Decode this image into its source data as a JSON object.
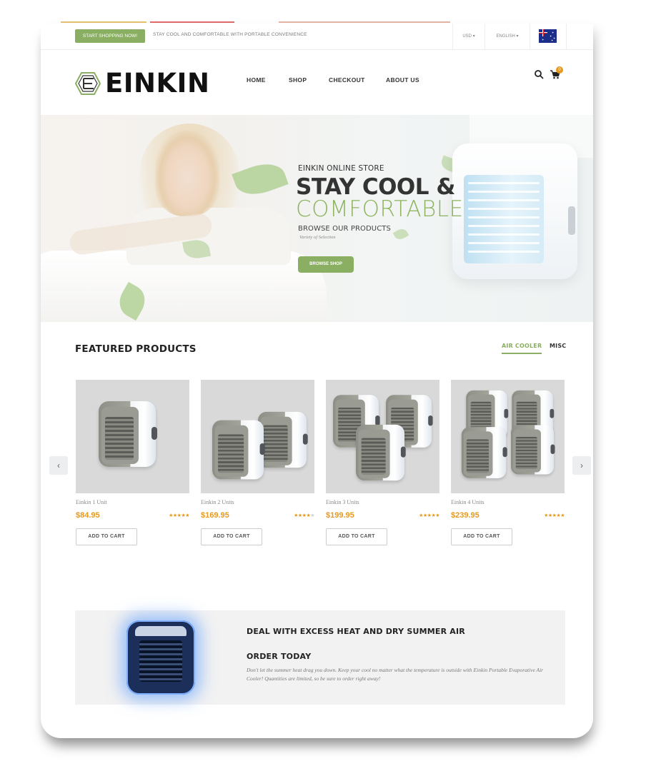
{
  "topbar": {
    "start_button": "START SHOPPING NOW!",
    "tagline": "STAY COOL AND COMFORTABLE WITH PORTABLE CONVENIENCE",
    "currency": "USD ▾",
    "language": "ENGLISH ▾"
  },
  "brand": {
    "name": "EINKIN"
  },
  "nav": {
    "home": "HOME",
    "shop": "SHOP",
    "checkout": "CHECKOUT",
    "about": "ABOUT US"
  },
  "cart": {
    "count": "0"
  },
  "hero": {
    "kicker": "EINKIN ONLINE STORE",
    "title_line1": "STAY COOL &",
    "title_line2": "COMFORTABLE",
    "subtitle": "BROWSE OUR PRODUCTS",
    "note": "Variety of Selection",
    "button": "BROWSE SHOP"
  },
  "featured": {
    "title": "FEATURED PRODUCTS",
    "tabs": [
      "AIR COOLER",
      "MISC"
    ],
    "products": [
      {
        "name": "Einkin 1 Unit",
        "price": "$84.95",
        "stars": "★★★★★",
        "rating": 5,
        "button": "ADD TO CART"
      },
      {
        "name": "Einkin 2 Units",
        "price": "$169.95",
        "stars": "★★★★☆",
        "rating": 4,
        "button": "ADD TO CART"
      },
      {
        "name": "Einkin 3 Units",
        "price": "$199.95",
        "stars": "★★★★★",
        "rating": 5,
        "button": "ADD TO CART"
      },
      {
        "name": "Einkin 4 Units",
        "price": "$239.95",
        "stars": "★★★★★",
        "rating": 5,
        "button": "ADD TO CART"
      }
    ],
    "prev_arrow": "‹",
    "next_arrow": "›"
  },
  "deal": {
    "heading": "DEAL WITH EXCESS HEAT AND DRY SUMMER AIR",
    "subheading": "ORDER TODAY",
    "text": "Don't let the summer heat drag you down. Keep your cool no matter what the temperature is outside with Einkin Portable Evaporative Air Cooler! Quantities are limited, so be sure to order right away!"
  },
  "colors": {
    "accent_green": "#8aae62",
    "price_orange": "#e59a1d"
  },
  "icons": {
    "search": "search-icon",
    "cart": "cart-icon",
    "flag": "australia-flag-icon"
  }
}
